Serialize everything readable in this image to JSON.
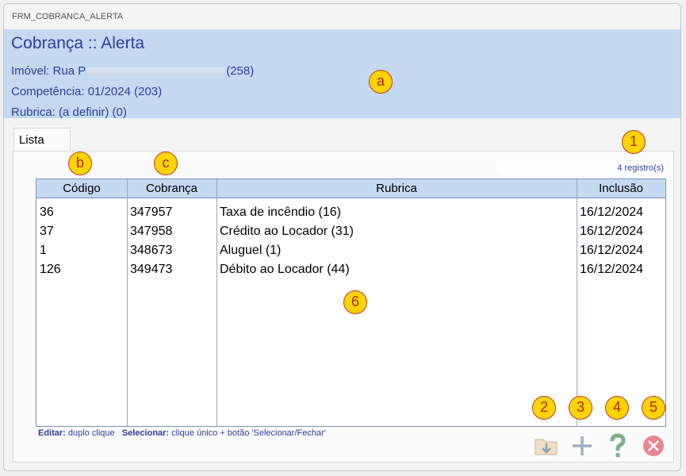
{
  "window": {
    "title": "FRM_COBRANCA_ALERTA"
  },
  "header": {
    "title": "Cobrança :: Alerta",
    "imovel_prefix": "Imóvel: Rua P",
    "imovel_suffix": "(258)",
    "competencia": "Competência: 01/2024 (203)",
    "rubrica": "Rubrica: (a definir) (0)"
  },
  "tabs": [
    {
      "label": "Lista"
    }
  ],
  "list": {
    "count_label": "4 registro(s)",
    "columns": [
      "Código",
      "Cobrança",
      "Rubrica",
      "Inclusão"
    ],
    "rows": [
      {
        "codigo": "36",
        "cobranca": "347957",
        "rubrica": "Taxa de incêndio (16)",
        "inclusao": "16/12/2024"
      },
      {
        "codigo": "37",
        "cobranca": "347958",
        "rubrica": "Crédito ao Locador (31)",
        "inclusao": "16/12/2024"
      },
      {
        "codigo": "1",
        "cobranca": "348673",
        "rubrica": "Aluguel (1)",
        "inclusao": "16/12/2024"
      },
      {
        "codigo": "126",
        "cobranca": "349473",
        "rubrica": "Débito ao Locador (44)",
        "inclusao": "16/12/2024"
      }
    ]
  },
  "hint": {
    "edit_label": "Editar:",
    "edit_text": "duplo clique",
    "select_label": "Selecionar:",
    "select_text": "clique único + botão 'Selecionar/Fechar'"
  },
  "buttons": [
    {
      "icon": "export-icon"
    },
    {
      "icon": "add-icon"
    },
    {
      "icon": "help-icon"
    },
    {
      "icon": "close-icon"
    }
  ],
  "markers": [
    "a",
    "b",
    "c",
    "1",
    "2",
    "3",
    "4",
    "5",
    "6"
  ],
  "colors": {
    "header_bg": "#c5d9f1",
    "header_text": "#2c3e9e",
    "marker_fill": "#ffd400",
    "marker_border": "#c0392b"
  }
}
